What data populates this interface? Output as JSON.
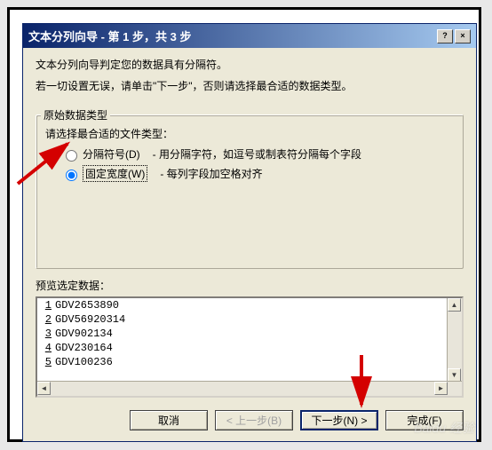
{
  "title": "文本分列向导 - 第 1 步，共 3 步",
  "title_help": "?",
  "title_close": "×",
  "intro_line1": "文本分列向导判定您的数据具有分隔符。",
  "intro_line2": "若一切设置无误，请单击\"下一步\"，否则请选择最合适的数据类型。",
  "fieldset_title": "原始数据类型",
  "choose_label": "请选择最合适的文件类型：",
  "radio1": {
    "label": "分隔符号(D)",
    "desc": "- 用分隔字符，如逗号或制表符分隔每个字段",
    "checked": false
  },
  "radio2": {
    "label": "固定宽度(W)",
    "desc": "- 每列字段加空格对齐",
    "checked": true
  },
  "preview_label": "预览选定数据：",
  "preview_rows": [
    {
      "n": "1",
      "text": "GDV2653890"
    },
    {
      "n": "2",
      "text": "GDV56920314"
    },
    {
      "n": "3",
      "text": "GDV902134"
    },
    {
      "n": "4",
      "text": "GDV230164"
    },
    {
      "n": "5",
      "text": "GDV100236"
    }
  ],
  "buttons": {
    "cancel": "取消",
    "back": "< 上一步(B)",
    "next": "下一步(N) >",
    "finish": "完成(F)"
  },
  "watermark": "Baidu 经验"
}
